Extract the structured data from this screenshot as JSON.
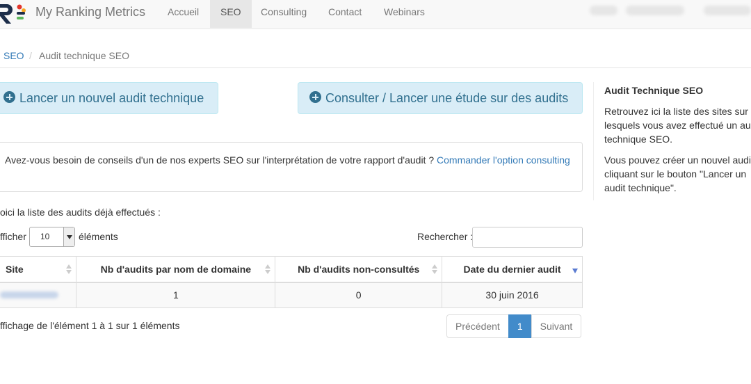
{
  "navbar": {
    "brand": "My Ranking Metrics",
    "items": [
      {
        "label": "Accueil"
      },
      {
        "label": "SEO"
      },
      {
        "label": "Consulting"
      },
      {
        "label": "Contact"
      },
      {
        "label": "Webinars"
      }
    ],
    "colors": {
      "logo_dark": "#1d2e4a",
      "logo_red": "#e4352b",
      "logo_orange": "#f5a623",
      "logo_green": "#5cb85c"
    }
  },
  "breadcrumb": {
    "parent": "SEO",
    "separator": "/",
    "current": "Audit technique SEO"
  },
  "buttons": {
    "new_audit": "Lancer un nouvel audit technique",
    "study": "Consulter / Lancer une étude sur des audits"
  },
  "consulting": {
    "text": "Avez-vous besoin de conseils d'un de nos experts SEO sur l'interprétation de votre rapport d'audit ? ",
    "link": "Commander l'option consulting"
  },
  "list_intro": "oici la liste des audits déjà effectués :",
  "table_controls": {
    "length_label": "fficher",
    "length_value": "10",
    "length_after": "éléments",
    "search_label": "Rechercher :"
  },
  "table": {
    "columns": [
      "Site",
      "Nb d'audits par nom de domaine",
      "Nb d'audits non-consultés",
      "Date du dernier audit"
    ],
    "rows": [
      {
        "nb_audits": "1",
        "nb_non_consultes": "0",
        "date": "30 juin 2016"
      }
    ]
  },
  "info": "ffichage de l'élément 1 à 1 sur 1 éléments",
  "pagination": {
    "previous": "Précédent",
    "current": "1",
    "next": "Suivant"
  },
  "sidebar": {
    "title": "Audit Technique SEO",
    "p1_lines": [
      "Retrouvez ici la liste des sites sur",
      "lesquels vous avez effectué un au",
      "technique SEO."
    ],
    "p2_lines": [
      "Vous pouvez créer un nouvel audi",
      "cliquant sur le bouton \"Lancer un",
      "audit technique\"."
    ]
  }
}
